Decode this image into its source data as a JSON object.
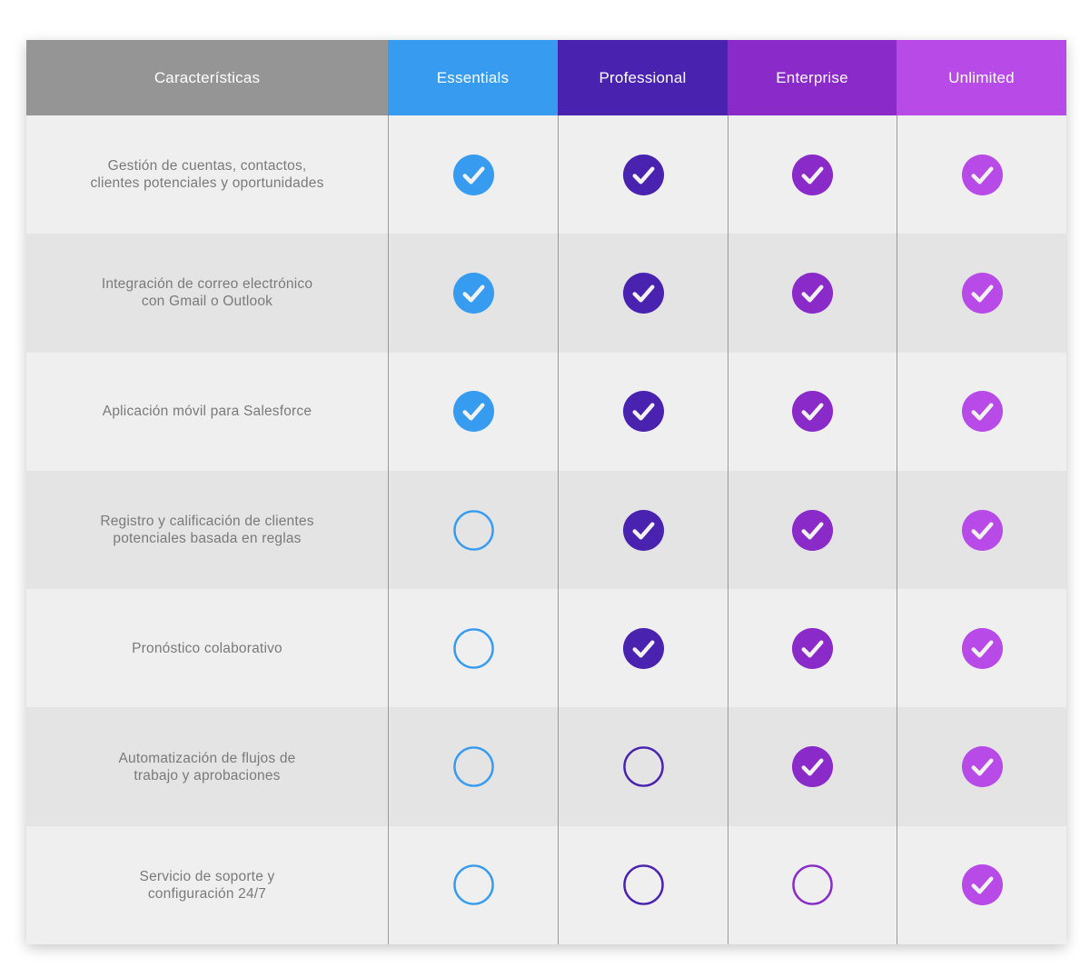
{
  "header": {
    "features_label": "Características",
    "features_color": "#959595",
    "plans": [
      {
        "name": "Essentials",
        "color": "#379cf0"
      },
      {
        "name": "Professional",
        "color": "#4a22b0"
      },
      {
        "name": "Enterprise",
        "color": "#8a2ac9"
      },
      {
        "name": "Unlimited",
        "color": "#b84ae8"
      }
    ]
  },
  "rows": [
    {
      "feature": "Gestión de cuentas, contactos,\nclientes potenciales y oportunidades",
      "included": [
        true,
        true,
        true,
        true
      ]
    },
    {
      "feature": "Integración de correo electrónico\ncon Gmail o Outlook",
      "included": [
        true,
        true,
        true,
        true
      ]
    },
    {
      "feature": "Aplicación móvil para Salesforce",
      "included": [
        true,
        true,
        true,
        true
      ]
    },
    {
      "feature": "Registro y calificación de clientes\npotenciales basada en reglas",
      "included": [
        false,
        true,
        true,
        true
      ]
    },
    {
      "feature": "Pronóstico colaborativo",
      "included": [
        false,
        true,
        true,
        true
      ]
    },
    {
      "feature": "Automatización de flujos de\ntrabajo y aprobaciones",
      "included": [
        false,
        false,
        true,
        true
      ]
    },
    {
      "feature": "Servicio de soporte y\nconfiguración 24/7",
      "included": [
        false,
        false,
        false,
        true
      ]
    }
  ],
  "icons": {
    "included": "check-circle-icon",
    "not_included": "empty-circle-icon"
  }
}
